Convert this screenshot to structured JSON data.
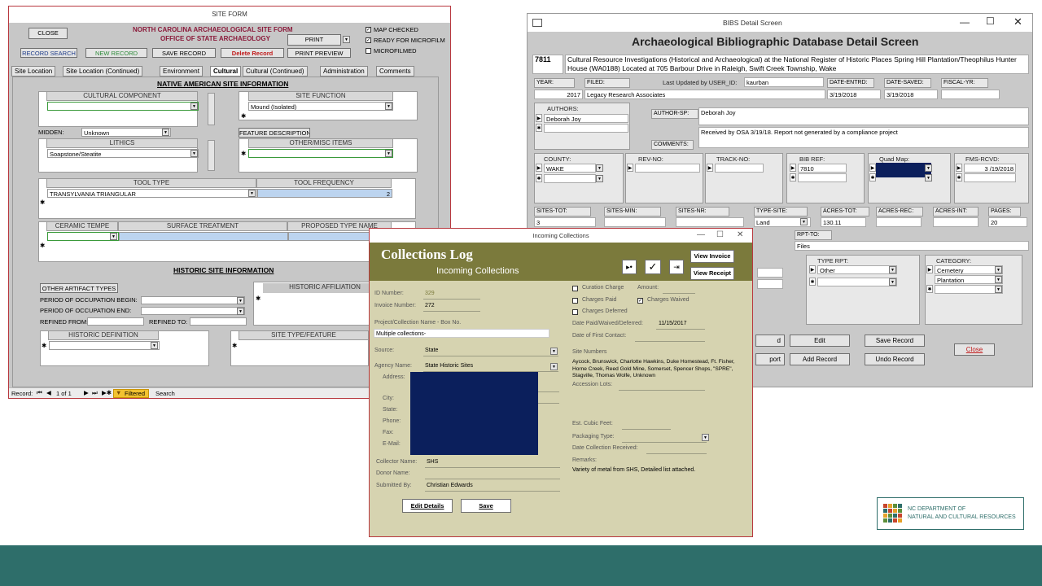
{
  "site_form": {
    "title": "SITE FORM",
    "close": "CLOSE",
    "heading1": "NORTH CAROLINA ARCHAEOLOGICAL SITE FORM",
    "heading2": "OFFICE OF STATE ARCHAEOLOGY",
    "print": "PRINT",
    "map_checked": "MAP CHECKED",
    "ready_microfilm": "READY FOR MICROFILM",
    "microfilmed": "MICROFILMED",
    "record_search": "RECORD SEARCH",
    "new_record": "NEW RECORD",
    "save_record": "SAVE RECORD",
    "delete_record": "Delete Record",
    "print_preview": "PRINT PREVIEW",
    "tabs": [
      "Site Location",
      "Site Location (Continued)",
      "Environment",
      "Cultural",
      "Cultural (Continued)",
      "Administration",
      "Comments"
    ],
    "native_title": "NATIVE AMERICAN SITE INFORMATION",
    "cultural_component": "CULTURAL COMPONENT",
    "site_function": "SITE FUNCTION",
    "site_function_value": "Mound (Isolated)",
    "midden_label": "MIDDEN:",
    "midden_value": "Unknown",
    "feature_description": "FEATURE DESCRIPTION",
    "lithics": "LITHICS",
    "lithics_value": "Soapstone/Steatite",
    "other_misc": "OTHER/MISC ITEMS",
    "tool_type": "TOOL TYPE",
    "tool_frequency": "TOOL FREQUENCY",
    "tool_type_value": "TRANSYLVANIA TRIANGULAR",
    "tool_frequency_value": "2",
    "ceramic_temper": "CERAMIC TEMPE",
    "surface_treatment": "SURFACE TREATMENT",
    "proposed_type": "PROPOSED TYPE NAME",
    "historic_title": "HISTORIC SITE INFORMATION",
    "other_artifact": "OTHER ARTIFACT TYPES",
    "historic_affiliation": "HISTORIC AFFILIATION",
    "period_begin": "PERIOD OF OCCUPATION BEGIN:",
    "period_end": "PERIOD OF OCCUPATION END:",
    "refined_from": "REFINED FROM:",
    "refined_to": "REFINED TO:",
    "historic_definition": "HISTORIC DEFINITION",
    "site_type_feature": "SITE TYPE/FEATURE",
    "status": {
      "record": "Record:",
      "count": "1 of 1",
      "filtered": "Filtered",
      "search": "Search"
    }
  },
  "bibs": {
    "title": "BIBS Detail Screen",
    "heading": "Archaeological Bibliographic Database Detail Screen",
    "id": "7811",
    "ref_title": "Cultural Resource Investigations (Historical and Archaeological) at the National Register of Historic Places Spring Hill Plantation/Theophilus Hunter House (WA0188) Located at 705 Barbour Drive in Raleigh, Swift Creek Township, Wake",
    "year_label": "YEAR:",
    "year": "2017",
    "filed_label": "FILED:",
    "filed": "Legacy Research Associates",
    "updated_label": "Last Updated by USER_ID:",
    "user_id": "kaurban",
    "date_entrd_label": "DATE-ENTRD:",
    "date_entrd": "3/19/2018",
    "date_saved_label": "DATE-SAVED:",
    "date_saved": "3/19/2018",
    "fiscal_label": "FISCAL-YR:",
    "authors_label": "AUTHORS:",
    "author": "Deborah Joy",
    "author_sp_label": "AUTHOR-SP:",
    "author_sp": "Deborah Joy",
    "comments_label": "COMMENTS:",
    "comments": "Received by OSA 3/19/18. Report not generated by a compliance project",
    "county_label": "COUNTY:",
    "county": "WAKE",
    "rev_no_label": "REV-NO:",
    "track_no_label": "TRACK-NO:",
    "bib_ref_label": "BIB REF:",
    "bib_ref": "7810",
    "quad_map_label": "Quad Map:",
    "fms_rcvd_label": "FMS-RCVD:",
    "fms_rcvd": "3 /19/2018",
    "sites_tot_label": "SITES-TOT:",
    "sites_tot": "3",
    "sites_min_label": "SITES-MIN:",
    "sites_nr_label": "SITES-NR:",
    "type_site_label": "TYPE-SITE:",
    "type_site": "Land",
    "acres_tot_label": "ACRES-TOT:",
    "acres_tot": "130.11",
    "acres_rec_label": "ACRES-REC:",
    "acres_int_label": "ACRES-INT:",
    "pages_label": "PAGES:",
    "pages": "20",
    "rpt_to_label": "RPT-TO:",
    "rpt_to": "Files",
    "type_rpt_label": "TYPE RPT:",
    "type_rpt": "Other",
    "category_label": "CATEGORY:",
    "category": [
      "Cemetery",
      "Plantation"
    ],
    "edit": "Edit",
    "save_record": "Save Record",
    "add_record": "Add Record",
    "undo_record": "Undo Record",
    "close": "Close",
    "partial1": "d",
    "partial2": "port"
  },
  "collections": {
    "window_title": "Incoming Collections",
    "heading": "Collections Log",
    "subheading": "Incoming Collections",
    "view_invoice": "View Invoice",
    "view_receipt": "View Receipt",
    "id_label": "ID Number:",
    "id": "329",
    "invoice_label": "Invoice Number:",
    "invoice": "272",
    "project_label": "Project/Collection Name - Box No.",
    "project": "Multiple collections-",
    "source_label": "Source:",
    "source": "State",
    "agency_label": "Agency Name:",
    "agency": "State Historic Sites",
    "address_label": "Address:",
    "city_label": "City:",
    "state_label": "State:",
    "phone_label": "Phone:",
    "fax_label": "Fax:",
    "email_label": "E-Mail:",
    "collector_label": "Collector Name:",
    "collector": "SHS",
    "donor_label": "Donor Name:",
    "submitted_label": "Submitted By:",
    "submitted": "Christian Edwards",
    "edit_details": "Edit Details",
    "save": "Save",
    "curation_charge": "Curation Charge",
    "amount_label": "Amount:",
    "charges_paid": "Charges Paid",
    "charges_waived": "Charges Waived",
    "charges_deferred": "Charges Deferred",
    "date_paid_label": "Date Paid/Waived/Deferred:",
    "date_paid": "11/15/2017",
    "first_contact_label": "Date of First Contact:",
    "site_numbers_label": "Site Numbers",
    "site_numbers": "Aycock, Brunswick, Charlotte Hawkins, Duke Homestead, Ft. Fisher, Horne Creek, Reed Gold Mine, Somerset, Spencer Shops, \"SPRE\", Stagville, Thomas Wolfe, Unknown",
    "accession_label": "Accession Lots:",
    "cubic_feet_label": "Est. Cubic Feet:",
    "packaging_label": "Packaging Type:",
    "date_received_label": "Date Collection Received:",
    "remarks_label": "Remarks:",
    "remarks": "Variety of metal from SHS, Detailed list attached."
  },
  "footer": {
    "org_line1": "NC DEPARTMENT OF",
    "org_line2": "NATURAL AND CULTURAL RESOURCES"
  },
  "colors": {
    "footer_teal": "#2e6e6a",
    "collections_header": "#7b7a3c",
    "collections_body": "#d6d3b0",
    "redaction": "#0b1f5c",
    "site_form_heading": "#8b1a3a"
  }
}
